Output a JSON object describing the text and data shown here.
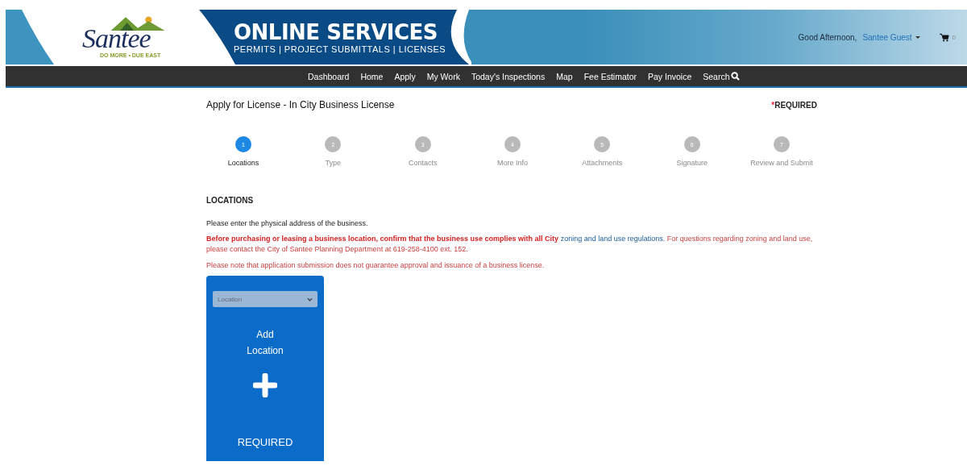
{
  "logo": {
    "name": "Santee",
    "tagline": "DO MORE • DUE EAST"
  },
  "banner": {
    "title": "ONLINE SERVICES",
    "subtitle": "PERMITS | PROJECT SUBMITTALS | LICENSES"
  },
  "user": {
    "greeting": "Good Afternoon,",
    "name": "Santee Guest",
    "cart_count": "0"
  },
  "nav": [
    {
      "label": "Dashboard"
    },
    {
      "label": "Home"
    },
    {
      "label": "Apply"
    },
    {
      "label": "My Work"
    },
    {
      "label": "Today's Inspections"
    },
    {
      "label": "Map"
    },
    {
      "label": "Fee Estimator"
    },
    {
      "label": "Pay Invoice"
    },
    {
      "label": "Search",
      "kind": "search"
    }
  ],
  "page": {
    "title": "Apply for License - In City Business License",
    "required_mark": "*",
    "required_label": "REQUIRED"
  },
  "steps": [
    {
      "number": "1",
      "label": "Locations",
      "selected": true
    },
    {
      "number": "2",
      "label": "Type",
      "selected": false
    },
    {
      "number": "3",
      "label": "Contacts",
      "selected": false
    },
    {
      "number": "4",
      "label": "More Info",
      "selected": false
    },
    {
      "number": "5",
      "label": "Attachments",
      "selected": false
    },
    {
      "number": "6",
      "label": "Signature",
      "selected": false
    },
    {
      "number": "7",
      "label": "Review and Submit",
      "selected": false
    }
  ],
  "section": {
    "heading": "LOCATIONS",
    "intro": "Please enter the physical address of the business.",
    "warning": {
      "bold": "Before purchasing or leasing a business location, confirm that the business use complies with all City",
      "link": "zoning and land use regulations.",
      "rest": "For questions regarding zoning and land use, please contact the City of Santee Planning Department at 619-258-4100 ext. 152."
    },
    "note": "Please note that application submission does not guarantee approval and issuance of a business license."
  },
  "location_card": {
    "select_placeholder": "Location",
    "title_line1": "Add",
    "title_line2": "Location",
    "status": "REQUIRED"
  }
}
